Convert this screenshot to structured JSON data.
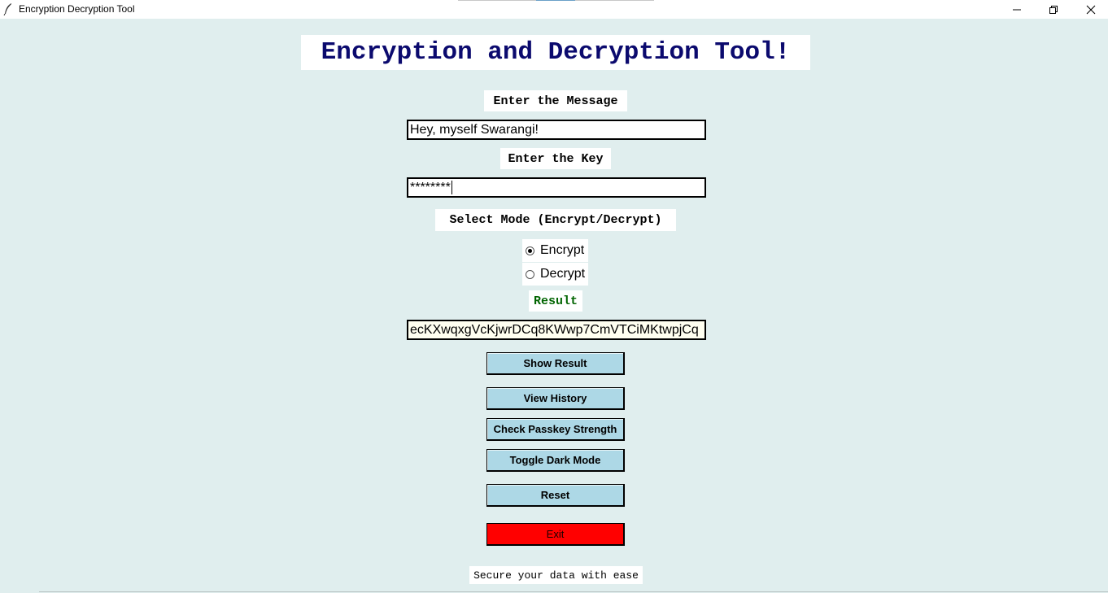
{
  "window": {
    "title": "Encryption Decryption Tool",
    "controls": [
      "minimize",
      "restore",
      "close"
    ]
  },
  "main": {
    "heading": "Encryption and Decryption Tool!",
    "message_label": "Enter the Message",
    "message_value": "Hey, myself Swarangi!",
    "key_label": "Enter the Key",
    "key_value": "********",
    "mode_label": "Select Mode (Encrypt/Decrypt)",
    "modes": [
      {
        "label": "Encrypt",
        "selected": true
      },
      {
        "label": "Decrypt",
        "selected": false
      }
    ],
    "result_label": "Result",
    "result_value": "ecKXwqxgVcKjwrDCq8KWwp7CmVTCiMKtwpjCq",
    "buttons": {
      "show_result": "Show Result",
      "view_history": "View History",
      "check_strength": "Check Passkey Strength",
      "toggle_dark": "Toggle Dark Mode",
      "reset": "Reset",
      "exit": "Exit"
    },
    "footer": "Secure your data with ease"
  },
  "colors": {
    "background": "#e0eeee",
    "heading": "#0b0a6e",
    "result_label": "#006400",
    "button": "#add8e6",
    "exit_button": "#ff0000"
  }
}
